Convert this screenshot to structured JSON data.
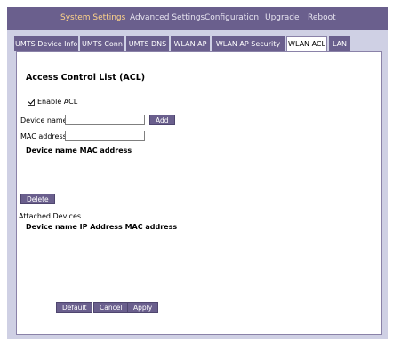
{
  "nav": {
    "items": [
      "System Settings",
      "Advanced Settings",
      "Configuration",
      "Upgrade",
      "Reboot"
    ]
  },
  "tabs": [
    "UMTS Device Info",
    "UMTS Conn",
    "UMTS DNS",
    "WLAN AP",
    "WLAN AP Security",
    "WLAN ACL",
    "LAN"
  ],
  "acl": {
    "title": "Access Control List (ACL)",
    "enable_label": "Enable ACL",
    "device_name_label": "Device name",
    "device_name_value": "",
    "mac_label": "MAC address",
    "mac_value": "",
    "add_label": "Add",
    "table_header": "Device name MAC address",
    "delete_label": "Delete",
    "attached_label": "Attached Devices",
    "attached_header": "Device name IP Address MAC address"
  },
  "footer": {
    "default_label": "Default",
    "cancel_label": "Cancel",
    "apply_label": "Apply"
  }
}
